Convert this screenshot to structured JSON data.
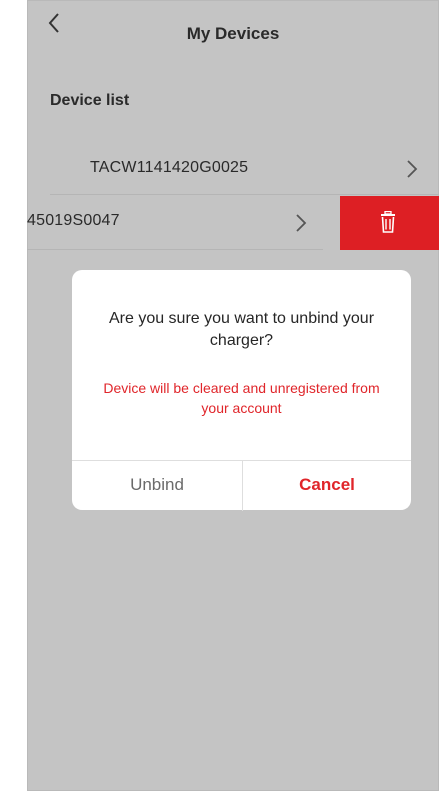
{
  "header": {
    "title": "My Devices",
    "back_icon": "chevron-left-icon"
  },
  "device_list": {
    "section_title": "Device list",
    "items": [
      {
        "label": "TACW1141420G0025"
      },
      {
        "label": "45019S0047",
        "delete_icon": "trash-icon"
      }
    ]
  },
  "dialog": {
    "question": "Are you sure you want to unbind your charger?",
    "warning": "Device will be cleared and unregistered from your account",
    "unbind_label": "Unbind",
    "cancel_label": "Cancel"
  },
  "colors": {
    "accent_red": "#dd1f24",
    "overlay_gray": "#c4c4c4"
  }
}
